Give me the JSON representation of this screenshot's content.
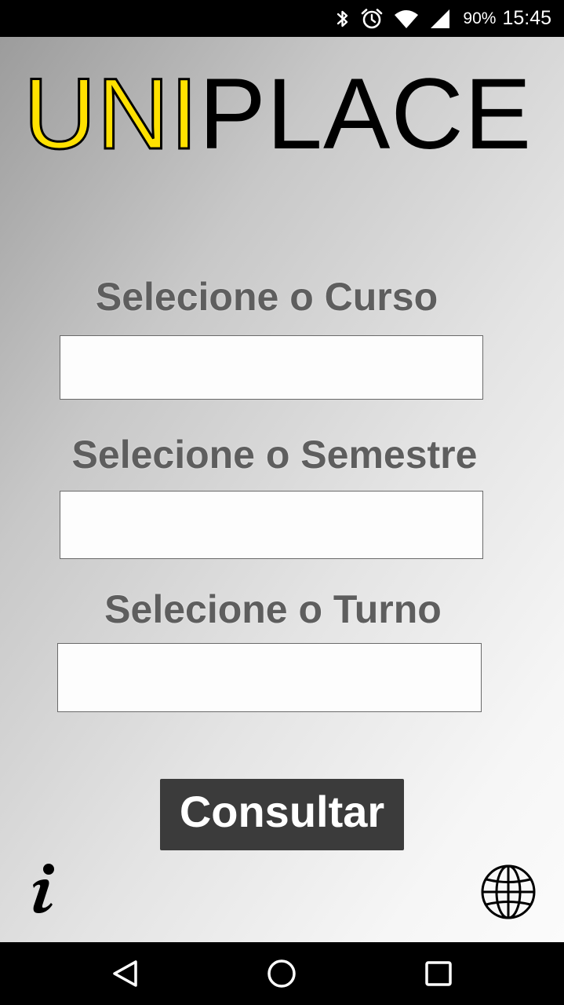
{
  "status_bar": {
    "battery": "90%",
    "time": "15:45",
    "icons": [
      "bluetooth-icon",
      "alarm-icon",
      "wifi-icon",
      "signal-icon"
    ]
  },
  "logo": {
    "part1": "UNI",
    "part2": "PLACE",
    "colors": {
      "part1": "#ffe100",
      "part2": "#000000"
    }
  },
  "form": {
    "curso_label": "Selecione o Curso",
    "curso_value": "",
    "semestre_label": "Selecione o Semestre",
    "semestre_value": "",
    "turno_label": "Selecione o Turno",
    "turno_value": "",
    "consult_label": "Consultar"
  },
  "footer_icons": [
    "info-icon",
    "globe-icon"
  ],
  "nav_bar": {
    "buttons": [
      "back-icon",
      "home-icon",
      "recent-apps-icon"
    ]
  },
  "colors": {
    "button_bg": "#3b3b3b",
    "label_text": "#5e5e5e",
    "status_bar_bg": "#000000"
  }
}
